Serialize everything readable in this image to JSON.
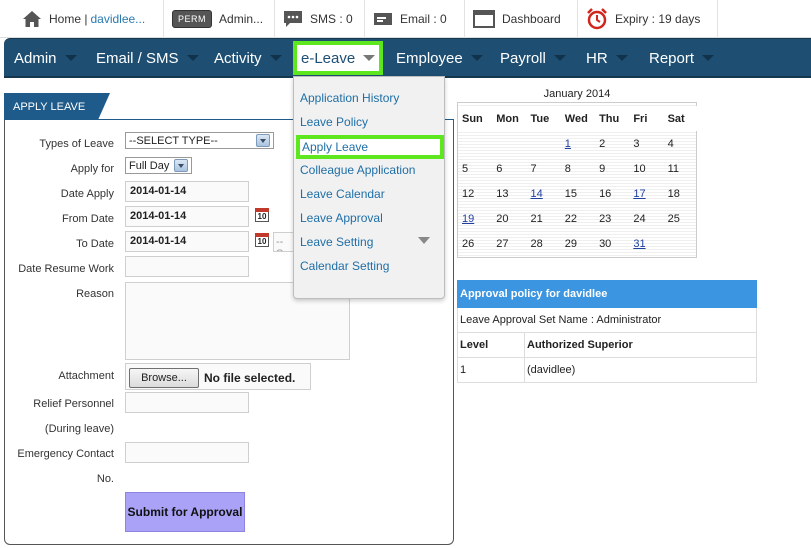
{
  "topbar": {
    "home_label": "Home |",
    "user_link": "davidlee...",
    "perm_badge": "PERM",
    "admin_label": "Admin...",
    "sms_label": "SMS : 0",
    "email_label": "Email : 0",
    "dashboard_label": "Dashboard",
    "expiry_label": "Expiry : 19 days"
  },
  "nav": {
    "items": [
      "Admin",
      "Email / SMS",
      "Activity",
      "e-Leave",
      "Employee",
      "Payroll",
      "HR",
      "Report"
    ],
    "active": "e-Leave"
  },
  "dropdown": {
    "items": [
      "Application History",
      "Leave Policy",
      "Apply Leave",
      "Colleague Application",
      "Leave Calendar",
      "Leave Approval",
      "Leave Setting",
      "Calendar Setting"
    ],
    "selected": "Apply Leave"
  },
  "tab_label": "APPLY LEAVE",
  "form": {
    "labels": {
      "types_of_leave": "Types of Leave",
      "apply_for": "Apply for",
      "date_apply": "Date Apply",
      "from_date": "From Date",
      "to_date": "To Date",
      "date_resume": "Date Resume Work",
      "reason": "Reason",
      "attachment": "Attachment",
      "relief_1": "Relief Personnel",
      "relief_2": "(During leave)",
      "emergency_1": "Emergency Contact",
      "emergency_2": "No."
    },
    "types_value": "--SELECT TYPE--",
    "apply_for_value": "Full Day",
    "date_apply_value": "2014-01-14",
    "from_date_value": "2014-01-14",
    "to_date_value": "2014-01-14",
    "to_date_extra": "-- S",
    "cal_icon_text": "10",
    "browse_label": "Browse...",
    "no_file_label": "No file selected.",
    "submit_label": "Submit for Approval"
  },
  "calendar": {
    "title": "January 2014",
    "weekdays": [
      "Sun",
      "Mon",
      "Tue",
      "Wed",
      "Thu",
      "Fri",
      "Sat"
    ],
    "weeks": [
      [
        "",
        "",
        "",
        "1",
        "2",
        "3",
        "4"
      ],
      [
        "5",
        "6",
        "7",
        "8",
        "9",
        "10",
        "11"
      ],
      [
        "12",
        "13",
        "14",
        "15",
        "16",
        "17",
        "18"
      ],
      [
        "19",
        "20",
        "21",
        "22",
        "23",
        "24",
        "25"
      ],
      [
        "26",
        "27",
        "28",
        "29",
        "30",
        "31",
        ""
      ]
    ],
    "linked_days": [
      "1",
      "14",
      "17",
      "19",
      "31"
    ]
  },
  "approval": {
    "title": "Approval policy for davidlee",
    "set_name": "Leave Approval Set Name : Administrator",
    "col_level": "Level",
    "col_superior": "Authorized Superior",
    "rows": [
      {
        "level": "1",
        "superior": "(davidlee)"
      }
    ]
  },
  "colors": {
    "nav_bg": "#1e4f73",
    "highlight": "#5ee61f",
    "link": "#1f6fa6",
    "approval_header": "#3b95e0",
    "submit_bg": "#a9a2f6"
  }
}
